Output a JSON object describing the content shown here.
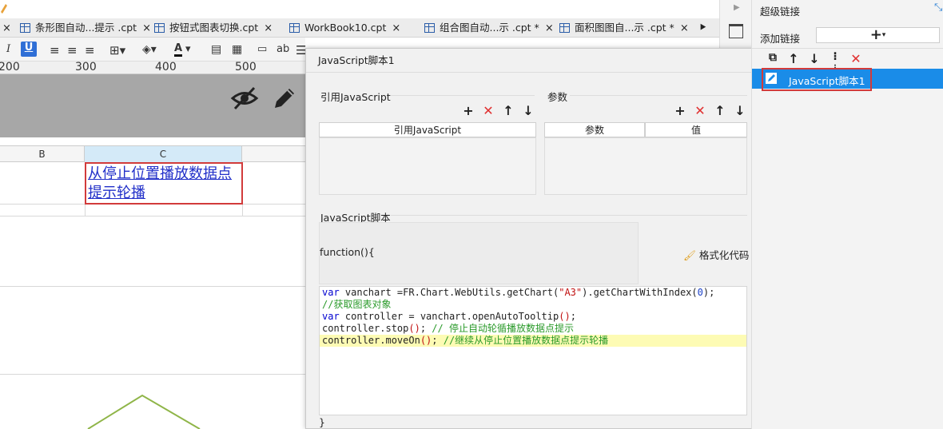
{
  "tabs": [
    {
      "label": "条形图自动...提示 .cpt"
    },
    {
      "label": "按钮式图表切换.cpt"
    },
    {
      "label": "WorkBook10.cpt"
    },
    {
      "label": "组合图自动...示  .cpt *"
    },
    {
      "label": "面积图图自...示 .cpt *"
    }
  ],
  "tab_close": "×",
  "toolbar": {
    "italic": "I",
    "underline": "U",
    "text_label": "ab"
  },
  "ruler": {
    "ticks": [
      "200",
      "300",
      "400",
      "500"
    ]
  },
  "sheet": {
    "col_b": "B",
    "col_c": "C",
    "cell_c_text_line1": "从停止位置播放数据点",
    "cell_c_text_line2": "提示轮播"
  },
  "dialog": {
    "title": "JavaScript脚本1",
    "ref_js_section": "引用JavaScript",
    "params_section": "参数",
    "ref_js_col": "引用JavaScript",
    "params_col": "参数",
    "value_col": "值",
    "script_section": "JavaScript脚本",
    "function_header": "function(){",
    "format_code_label": "格式化代码",
    "closing_brace": "}"
  },
  "code_lines": [
    [
      {
        "t": "var",
        "c": "kw"
      },
      {
        "t": " vanchart =FR.Chart.WebUtils.getChart("
      },
      {
        "t": "\"A3\"",
        "c": "str"
      },
      {
        "t": ").getChartWithIndex("
      },
      {
        "t": "0",
        "c": "num"
      },
      {
        "t": ");"
      }
    ],
    [
      {
        "t": "//获取图表对象",
        "c": "cm"
      }
    ],
    [
      {
        "t": "var",
        "c": "kw"
      },
      {
        "t": " controller = vanchart.openAutoTooltip"
      },
      {
        "t": "()",
        "c": "str"
      },
      {
        "t": ";"
      }
    ],
    [
      {
        "t": "controller.stop"
      },
      {
        "t": "()",
        "c": "str"
      },
      {
        "t": "; "
      },
      {
        "t": "// 停止自动轮循播放数据点提示",
        "c": "cm"
      }
    ],
    [
      {
        "t": "controller.moveOn"
      },
      {
        "t": "()",
        "c": "str"
      },
      {
        "t": "; "
      },
      {
        "t": "//继续从停止位置播放数据点提示轮播",
        "c": "cm"
      }
    ]
  ],
  "right_panel": {
    "title": "超级链接",
    "add_link_label": "添加链接",
    "add_button": "+",
    "item_label": "JavaScript脚本1"
  },
  "colors": {
    "accent": "#1a8ce8",
    "red": "#e03030",
    "link": "#2230c9"
  }
}
